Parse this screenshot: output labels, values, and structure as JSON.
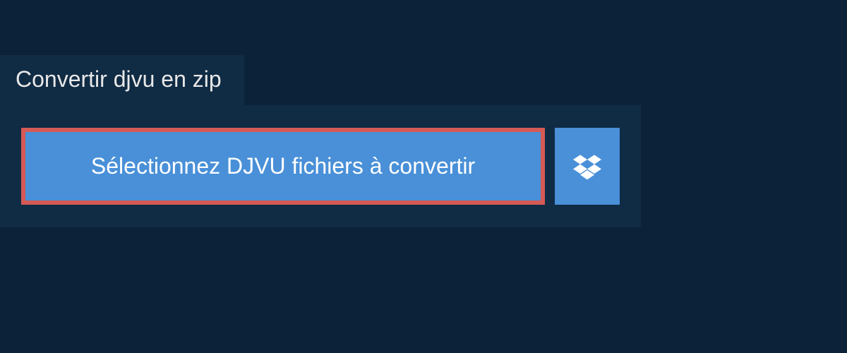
{
  "tab": {
    "label": "Convertir djvu en zip"
  },
  "buttons": {
    "select_files_label": "Sélectionnez DJVU fichiers à convertir"
  },
  "colors": {
    "background": "#0c2238",
    "panel": "#102b44",
    "button": "#4990d8",
    "highlight_border": "#d55a56"
  }
}
